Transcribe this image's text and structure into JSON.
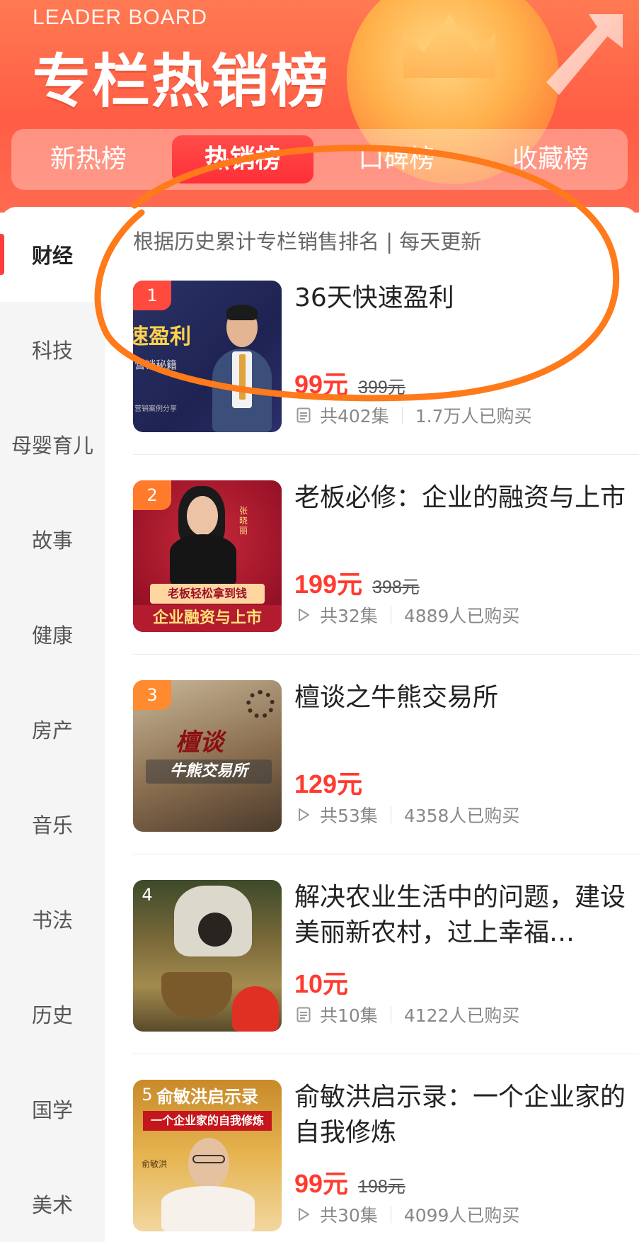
{
  "header": {
    "title_en": "LEADER BOARD",
    "title_cn": "专栏热销榜",
    "tabs": [
      {
        "label": "新热榜",
        "active": false
      },
      {
        "label": "热销榜",
        "active": true
      },
      {
        "label": "口碑榜",
        "active": false
      },
      {
        "label": "收藏榜",
        "active": false
      }
    ]
  },
  "sidebar": {
    "items": [
      {
        "label": "财经",
        "active": true
      },
      {
        "label": "科技"
      },
      {
        "label": "母婴育儿"
      },
      {
        "label": "故事"
      },
      {
        "label": "健康"
      },
      {
        "label": "房产"
      },
      {
        "label": "音乐"
      },
      {
        "label": "书法"
      },
      {
        "label": "历史"
      },
      {
        "label": "国学"
      },
      {
        "label": "美术"
      }
    ]
  },
  "main": {
    "subtitle": "根据历史累计专栏销售排名 | 每天更新",
    "items": [
      {
        "rank": "1",
        "title": "36天快速盈利",
        "price": "99元",
        "original_price": "399元",
        "episodes": "共402集",
        "buyers": "1.7万人已购买",
        "icon": "list-icon",
        "thumb": {
          "line1": "速盈利",
          "line2": "营销秘籍",
          "line3": "营销案例分享"
        }
      },
      {
        "rank": "2",
        "title": "老板必修：企业的融资与上市",
        "price": "199元",
        "original_price": "398元",
        "episodes": "共32集",
        "buyers": "4889人已购买",
        "icon": "play-icon",
        "thumb": {
          "line1": "老板轻松拿到钱",
          "line2": "企业融资与上市",
          "name": "张晓丽"
        }
      },
      {
        "rank": "3",
        "title": "檀谈之牛熊交易所",
        "price": "129元",
        "original_price": "",
        "episodes": "共53集",
        "buyers": "4358人已购买",
        "icon": "play-icon",
        "thumb": {
          "line1": "檀谈",
          "line2": "牛熊交易所"
        }
      },
      {
        "rank": "4",
        "title": "解决农业生活中的问题，建设美丽新农村，过上幸福…",
        "price": "10元",
        "original_price": "",
        "episodes": "共10集",
        "buyers": "4122人已购买",
        "icon": "list-icon",
        "thumb": {}
      },
      {
        "rank": "5",
        "title": "俞敏洪启示录：一个企业家的自我修炼",
        "price": "99元",
        "original_price": "198元",
        "episodes": "共30集",
        "buyers": "4099人已购买",
        "icon": "play-icon",
        "thumb": {
          "line1": "俞敏洪启示录",
          "line2": "一个企业家的自我修炼",
          "name": "俞敏洪"
        }
      }
    ]
  },
  "colors": {
    "accent_red": "#ff3b30",
    "header_orange": "#ff6a4b",
    "annotation_orange": "#ff7a1a",
    "rank1": "#ff4a3d",
    "rank2": "#ff7a2a",
    "rank3": "#ff8a30"
  }
}
